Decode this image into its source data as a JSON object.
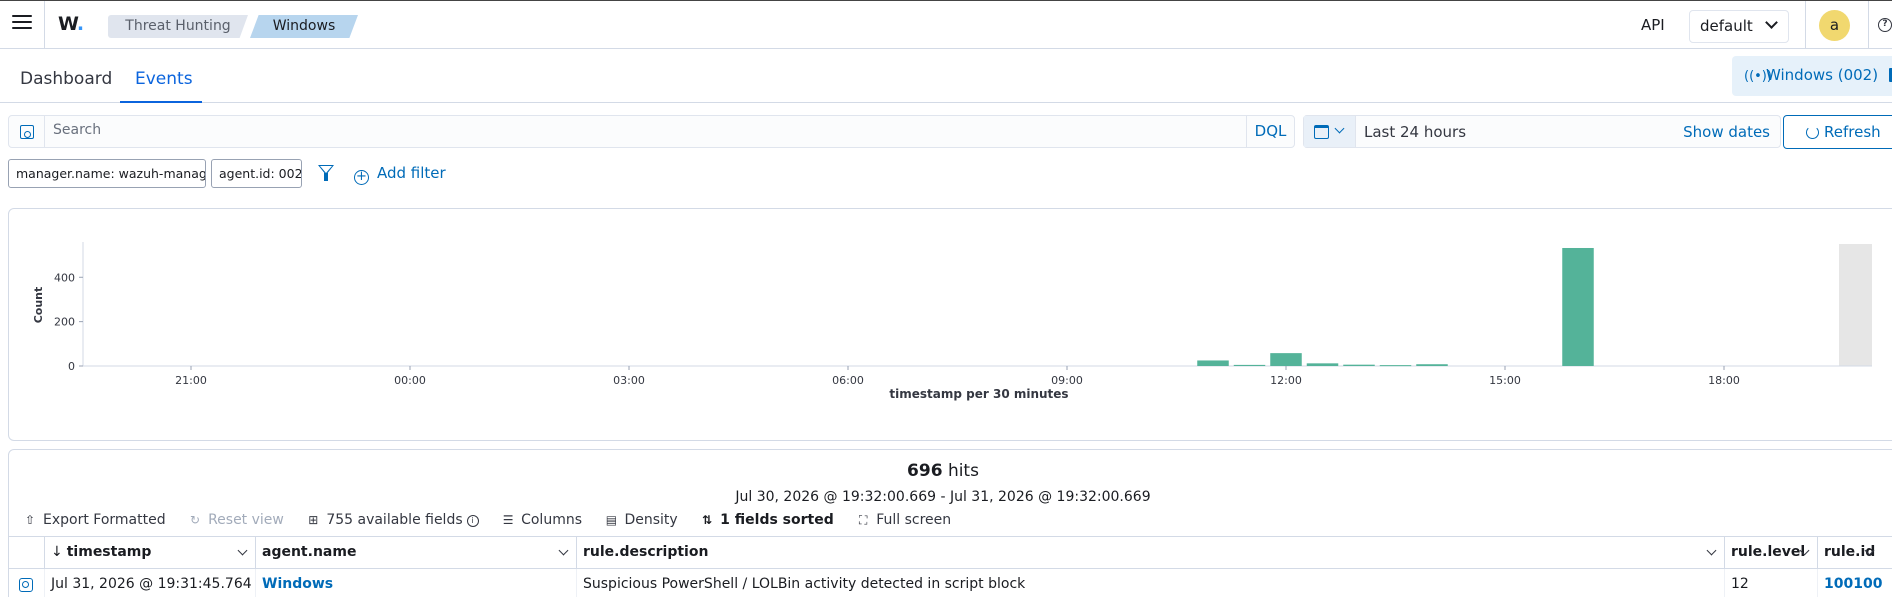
{
  "header": {
    "logo": "W",
    "breadcrumbs": [
      "Threat Hunting",
      "Windows"
    ],
    "api_link": "API",
    "space": "default",
    "avatar_initial": "a"
  },
  "tabs": [
    {
      "label": "Dashboard",
      "active": false
    },
    {
      "label": "Events",
      "active": true
    }
  ],
  "agent_chip": "Windows (002)",
  "search": {
    "placeholder": "Search",
    "value": "",
    "language": "DQL"
  },
  "time_picker": {
    "range": "Last 24 hours",
    "show_dates": "Show dates",
    "refresh": "Refresh"
  },
  "filters": [
    "manager.name: wazuh-manager",
    "agent.id: 002"
  ],
  "add_filter": "Add filter",
  "chart_data": {
    "type": "bar",
    "ylabel": "Count",
    "xlabel": "timestamp per 30 minutes",
    "ylim": [
      0,
      550
    ],
    "yticks": [
      0,
      200,
      400
    ],
    "x_tick_labels": [
      "21:00",
      "00:00",
      "03:00",
      "06:00",
      "09:00",
      "12:00",
      "15:00",
      "18:00"
    ],
    "x_tick_hours": [
      21,
      24,
      27,
      30,
      33,
      36,
      39,
      42
    ],
    "bars": [
      {
        "hour": 35.0,
        "value": 25
      },
      {
        "hour": 35.5,
        "value": 5
      },
      {
        "hour": 36.0,
        "value": 58
      },
      {
        "hour": 36.5,
        "value": 12
      },
      {
        "hour": 37.0,
        "value": 6
      },
      {
        "hour": 37.5,
        "value": 4
      },
      {
        "hour": 38.0,
        "value": 8
      },
      {
        "hour": 40.0,
        "value": 532
      }
    ],
    "color": "#54b399",
    "shade_color": "#e6e6e6"
  },
  "results": {
    "hits_count": "696",
    "hits_label": "hits",
    "range": "Jul 30, 2026 @ 19:32:00.669 - Jul 31, 2026 @ 19:32:00.669",
    "toolbar": {
      "export": "Export Formatted",
      "reset": "Reset view",
      "fields": "755 available fields",
      "columns": "Columns",
      "density": "Density",
      "sorted": "1 fields sorted",
      "fullscreen": "Full screen"
    },
    "columns": [
      "timestamp",
      "agent.name",
      "rule.description",
      "rule.level",
      "rule.id"
    ],
    "rows": [
      {
        "timestamp": "Jul 31, 2026 @ 19:31:45.764",
        "agent_name": "Windows",
        "rule_description": "Suspicious PowerShell / LOLBin activity detected in script block",
        "rule_level": "12",
        "rule_id": "100100"
      }
    ]
  }
}
